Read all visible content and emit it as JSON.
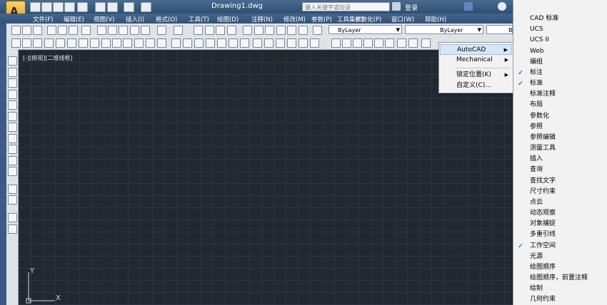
{
  "window": {
    "doc_title": "Drawing1.dwg",
    "search_placeholder": "键入关键字或短语",
    "login": "登录"
  },
  "menubar": {
    "items": [
      "文件(F)",
      "编辑(E)",
      "视图(V)",
      "插入(I)",
      "格式(O)",
      "工具(T)",
      "绘图(D)",
      "注释(N)",
      "修改(M)",
      "参数(P)",
      "工具集(C)",
      "参数化(P)",
      "窗口(W)",
      "帮助(H)"
    ]
  },
  "properties": {
    "layer": "ByLayer",
    "linetype": "ByLayer",
    "lineweight": "B"
  },
  "viewport": {
    "label": "[-][俯视][二维线框]"
  },
  "ucs": {
    "y": "Y",
    "x": "X"
  },
  "context_menu": {
    "items": [
      {
        "label": "AutoCAD",
        "submenu": true,
        "highlighted": true
      },
      {
        "label": "Mechanical",
        "submenu": true
      },
      {
        "label": "锁定位置(K)",
        "submenu": true
      },
      {
        "label": "自定义(C)..."
      }
    ]
  },
  "toolbar_menu": {
    "items": [
      {
        "label": "CAD 标准",
        "checked": false
      },
      {
        "label": "UCS",
        "checked": false
      },
      {
        "label": "UCS II",
        "checked": false
      },
      {
        "label": "Web",
        "checked": false
      },
      {
        "label": "编组",
        "checked": false
      },
      {
        "label": "标注",
        "checked": true
      },
      {
        "label": "标准",
        "checked": true
      },
      {
        "label": "标准注释",
        "checked": false
      },
      {
        "label": "布局",
        "checked": false
      },
      {
        "label": "参数化",
        "checked": false
      },
      {
        "label": "参照",
        "checked": false
      },
      {
        "label": "参照编辑",
        "checked": false
      },
      {
        "label": "测量工具",
        "checked": false
      },
      {
        "label": "插入",
        "checked": false
      },
      {
        "label": "查询",
        "checked": false
      },
      {
        "label": "查找文字",
        "checked": false
      },
      {
        "label": "尺寸约束",
        "checked": false
      },
      {
        "label": "点云",
        "checked": false
      },
      {
        "label": "动态观察",
        "checked": false
      },
      {
        "label": "对象捕捉",
        "checked": false
      },
      {
        "label": "多重引线",
        "checked": false
      },
      {
        "label": "工作空间",
        "checked": true
      },
      {
        "label": "光源",
        "checked": false
      },
      {
        "label": "绘图顺序",
        "checked": false
      },
      {
        "label": "绘图顺序，前置注释",
        "checked": false
      },
      {
        "label": "绘制",
        "checked": false
      },
      {
        "label": "几何约束",
        "checked": false
      }
    ]
  }
}
